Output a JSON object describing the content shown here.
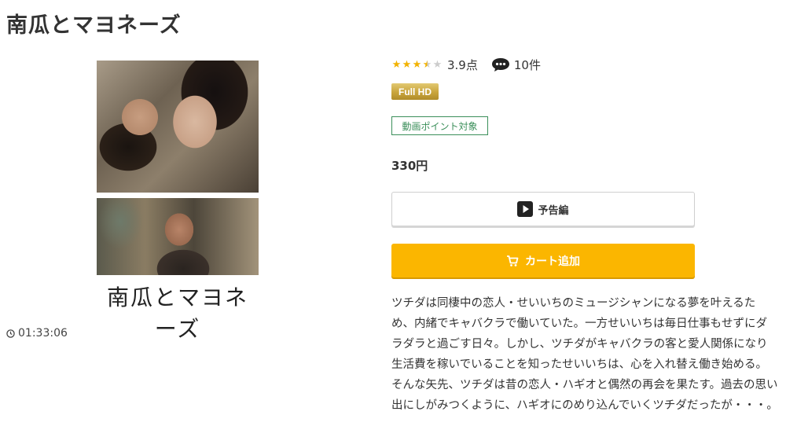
{
  "page": {
    "title": "南瓜とマヨネーズ"
  },
  "poster": {
    "title_text": "南瓜とマヨネーズ"
  },
  "duration": "01:33:06",
  "rating": {
    "stars": 3.5,
    "score": "3.9点",
    "reviews": "10件"
  },
  "badges": {
    "quality": "Full HD",
    "point": "動画ポイント対象"
  },
  "price": "330円",
  "buttons": {
    "trailer": "予告編",
    "cart": "カート追加"
  },
  "description": "ツチダは同棲中の恋人・せいいちのミュージシャンになる夢を叶えるため、内緒でキャバクラで働いていた。一方せいいちは毎日仕事もせずにダラダラと過ごす日々。しかし、ツチダがキャバクラの客と愛人関係になり生活費を稼いでいることを知ったせいいちは、心を入れ替え働き始める。そんな矢先、ツチダは昔の恋人・ハギオと偶然の再会を果たす。過去の思い出にしがみつくように、ハギオにのめり込んでいくツチダだったが・・・。",
  "colors": {
    "accent": "#fbb600",
    "star": "#f2b200",
    "point_green": "#3b8f5a",
    "fullhd_gold": "#c9a53c"
  },
  "icons": [
    "clock-icon",
    "star-icon",
    "comment-icon",
    "play-icon",
    "cart-icon"
  ]
}
